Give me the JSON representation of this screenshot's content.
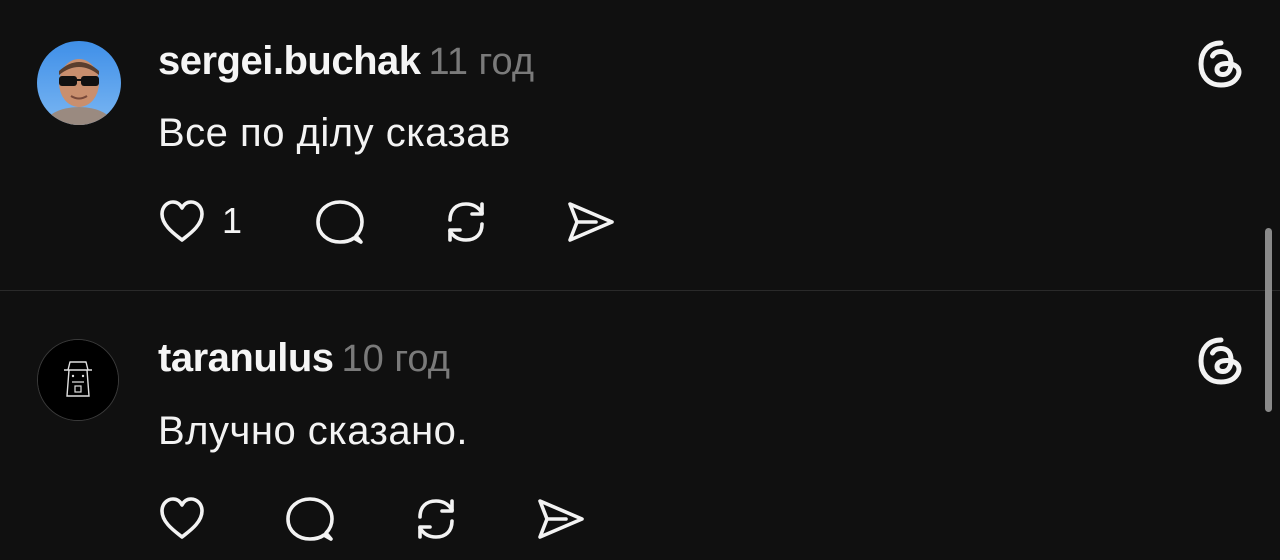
{
  "posts": [
    {
      "username": "sergei.buchak",
      "time": "11 год",
      "text": "Все по ділу сказав",
      "like_count": "1",
      "avatar_icon": "user-photo-sunglasses"
    },
    {
      "username": "taranulus",
      "time": "10 год",
      "text": "Влучно сказано.",
      "like_count": "",
      "avatar_icon": "hat-figure-doodle"
    }
  ],
  "icons": {
    "like": "heart-icon",
    "reply": "comment-bubble-icon",
    "repost": "repost-icon",
    "share": "send-icon",
    "brand": "threads-logo-icon"
  },
  "colors": {
    "background": "#101010",
    "text_primary": "#f3f3f3",
    "text_secondary": "#7a7a7a",
    "divider": "#2a2a2a"
  }
}
